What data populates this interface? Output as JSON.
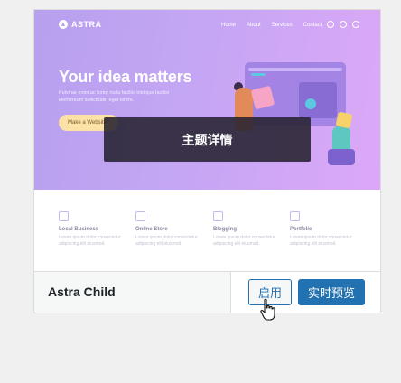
{
  "theme_card": {
    "screenshot": {
      "logo_text": "ASTRA",
      "nav_items": [
        "Home",
        "About",
        "Services",
        "Contact"
      ],
      "social_icons": [
        "instagram-icon",
        "facebook-icon",
        "twitter-icon"
      ],
      "hero_title": "Your idea matters",
      "hero_subtitle": "Pulvinar enim ac tortor nulla facilisi tristique facilisi elementum sollicitudin eget lorem.",
      "hero_button": "Make a Website",
      "features": [
        {
          "icon": "building-icon",
          "title": "Local Business",
          "text": "Lorem ipsum dolor consectetur adipiscing elit eiusmod."
        },
        {
          "icon": "bag-icon",
          "title": "Online Store",
          "text": "Lorem ipsum dolor consectetur adipiscing elit eiusmod."
        },
        {
          "icon": "pencil-icon",
          "title": "Blogging",
          "text": "Lorem ipsum dolor consectetur adipiscing elit eiusmod."
        },
        {
          "icon": "portfolio-icon",
          "title": "Portfolio",
          "text": "Lorem ipsum dolor consectetur adipiscing elit eiusmod."
        }
      ]
    },
    "details_overlay": "主题详情",
    "theme_name": "Astra Child",
    "activate_label": "启用",
    "live_preview_label": "实时预览"
  },
  "colors": {
    "primary_button": "#2271b1",
    "background": "#f0f0f1"
  }
}
